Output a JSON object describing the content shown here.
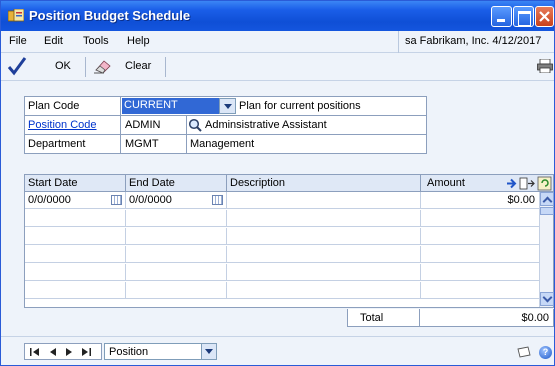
{
  "window": {
    "title": "Position Budget Schedule"
  },
  "menu": {
    "items": [
      "File",
      "Edit",
      "Tools",
      "Help"
    ],
    "user_info": "sa  Fabrikam, Inc.  4/12/2017"
  },
  "toolbar": {
    "ok_label": "OK",
    "clear_label": "Clear"
  },
  "header": {
    "plan_code": {
      "label": "Plan Code",
      "value": "CURRENT",
      "description": "Plan for current positions"
    },
    "position_code": {
      "label": "Position Code",
      "value": "ADMIN",
      "description": "Adminsistrative Assistant"
    },
    "department": {
      "label": "Department",
      "value": "MGMT",
      "description": "Management"
    }
  },
  "grid": {
    "columns": [
      "Start Date",
      "End Date",
      "Description",
      "Amount"
    ],
    "rows": [
      {
        "start_date": "0/0/0000",
        "end_date": "0/0/0000",
        "description": "",
        "amount": "$0.00"
      }
    ]
  },
  "total": {
    "label": "Total",
    "amount": "$0.00"
  },
  "footer": {
    "sort_by": "Position"
  },
  "colors": {
    "title_bar": "#1a5ee8",
    "selection": "#3168d5",
    "link": "#0033cc",
    "grid_header": "#dfe8f6"
  }
}
